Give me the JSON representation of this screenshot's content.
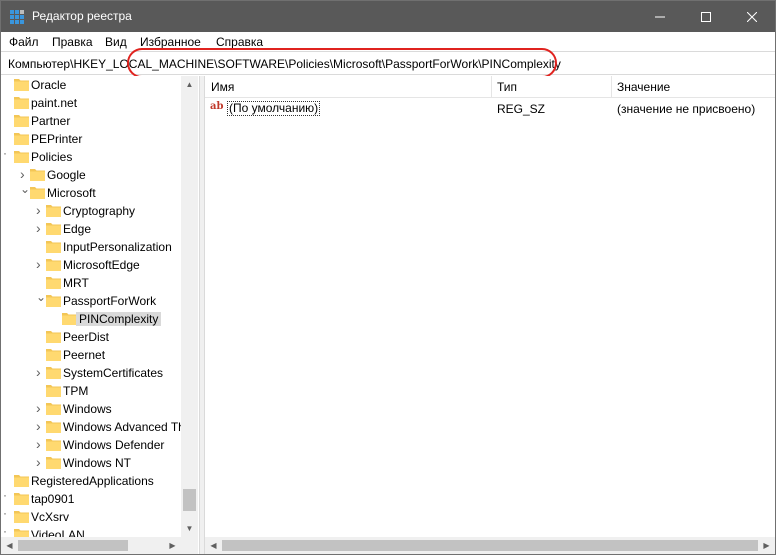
{
  "window": {
    "title": "Редактор реестра",
    "icon": "regedit-icon"
  },
  "menu": [
    "Файл",
    "Правка",
    "Вид",
    "Избранное",
    "Справка"
  ],
  "address": {
    "path": "Компьютер\\HKEY_LOCAL_MACHINE\\SOFTWARE\\Policies\\Microsoft\\PassportForWork\\PINComplexity",
    "highlight_color": "#e0231f"
  },
  "tree": {
    "items": [
      {
        "label": "Oracle",
        "level": 0,
        "expander": ""
      },
      {
        "label": "paint.net",
        "level": 0,
        "expander": ""
      },
      {
        "label": "Partner",
        "level": 0,
        "expander": ""
      },
      {
        "label": "PEPrinter",
        "level": 0,
        "expander": ""
      },
      {
        "label": "Policies",
        "level": 0,
        "expander": "collapsed-dot"
      },
      {
        "label": "Google",
        "level": 1,
        "expander": "right"
      },
      {
        "label": "Microsoft",
        "level": 1,
        "expander": "down"
      },
      {
        "label": "Cryptography",
        "level": 2,
        "expander": "right"
      },
      {
        "label": "Edge",
        "level": 2,
        "expander": "right"
      },
      {
        "label": "InputPersonalization",
        "level": 2,
        "expander": ""
      },
      {
        "label": "MicrosoftEdge",
        "level": 2,
        "expander": "right"
      },
      {
        "label": "MRT",
        "level": 2,
        "expander": ""
      },
      {
        "label": "PassportForWork",
        "level": 2,
        "expander": "down"
      },
      {
        "label": "PINComplexity",
        "level": 3,
        "expander": "",
        "selected": true
      },
      {
        "label": "PeerDist",
        "level": 2,
        "expander": ""
      },
      {
        "label": "Peernet",
        "level": 2,
        "expander": ""
      },
      {
        "label": "SystemCertificates",
        "level": 2,
        "expander": "right"
      },
      {
        "label": "TPM",
        "level": 2,
        "expander": ""
      },
      {
        "label": "Windows",
        "level": 2,
        "expander": "right"
      },
      {
        "label": "Windows Advanced Th",
        "level": 2,
        "expander": "right"
      },
      {
        "label": "Windows Defender",
        "level": 2,
        "expander": "right"
      },
      {
        "label": "Windows NT",
        "level": 2,
        "expander": "right"
      },
      {
        "label": "RegisteredApplications",
        "level": 0,
        "expander": ""
      },
      {
        "label": "tap0901",
        "level": 0,
        "expander": "collapsed-dot"
      },
      {
        "label": "VcXsrv",
        "level": 0,
        "expander": "collapsed-dot"
      },
      {
        "label": "VideoLAN",
        "level": 0,
        "expander": "collapsed-dot"
      }
    ]
  },
  "list": {
    "columns": [
      "Имя",
      "Тип",
      "Значение"
    ],
    "rows": [
      {
        "icon": "string-value-icon",
        "icon_text": "ab",
        "name": "(По умолчанию)",
        "type": "REG_SZ",
        "data": "(значение не присвоено)"
      }
    ]
  },
  "colors": {
    "titlebar": "#595959",
    "folder": "#f3c656",
    "selection": "#d9d9d9"
  }
}
